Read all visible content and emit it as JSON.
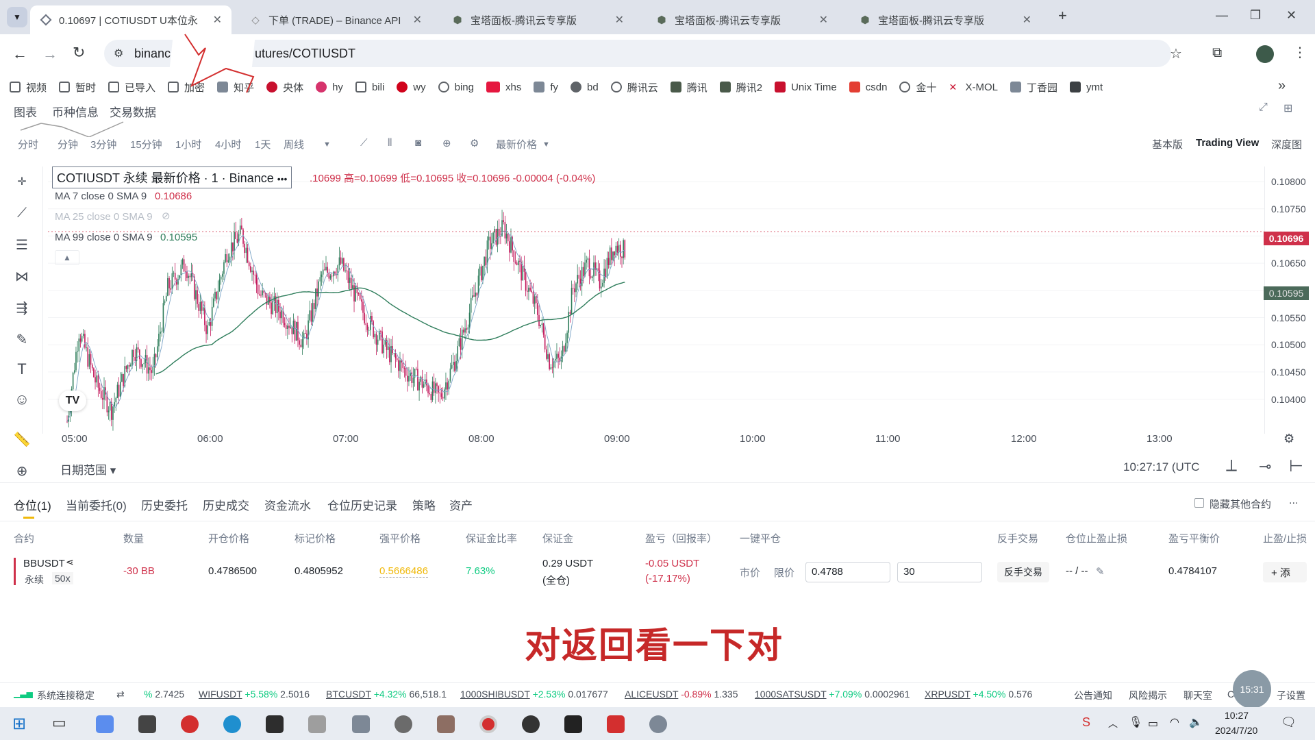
{
  "browser": {
    "tabs": [
      {
        "title": "0.10697 | COTIUSDT U本位永",
        "active": true
      },
      {
        "title": "下单 (TRADE) – Binance API",
        "active": false
      },
      {
        "title": "宝塔面板-腾讯云专享版",
        "active": false
      },
      {
        "title": "宝塔面板-腾讯云专享版",
        "active": false
      },
      {
        "title": "宝塔面板-腾讯云专享版",
        "active": false
      }
    ],
    "new_tab": "+",
    "url_start": "binanc",
    "url_end": "utures/COTIUSDT",
    "bookmarks": [
      "视频",
      "暂时",
      "已导入",
      "加密",
      "知乎",
      "央体",
      "hy",
      "bili",
      "wy",
      "bing",
      "xhs",
      "fy",
      "bd",
      "腾讯云",
      "腾讯",
      "腾讯2",
      "Unix Time",
      "csdn",
      "金十",
      "X-MOL",
      "丁香园",
      "ymt"
    ],
    "more_bookmarks": "»"
  },
  "subnav": [
    "图表",
    "币种信息",
    "交易数据"
  ],
  "intervals": [
    "分时",
    "分钟",
    "3分钟",
    "15分钟",
    "1小时",
    "4小时",
    "1天",
    "周线"
  ],
  "price_type": "最新价格",
  "view_modes": [
    "基本版",
    "Trading View",
    "深度图"
  ],
  "legend": {
    "title": "COTIUSDT 永续 最新价格 · 1 · Binance",
    "ohlc": ".10699 高=0.10699 低=0.10695 收=0.10696 -0.00004 (-0.04%)",
    "ma7": "MA 7 close 0 SMA 9",
    "ma7_val": "0.10686",
    "ma25": "MA 25 close 0 SMA 9",
    "ma99": "MA 99 close 0 SMA 9",
    "ma99_val": "0.10595"
  },
  "y_axis": [
    "0.10800",
    "0.10750",
    "0.10700",
    "0.10650",
    "0.10600",
    "0.10550",
    "0.10500",
    "0.10450",
    "0.10400"
  ],
  "price_tag": "0.10696",
  "ma_tag": "0.10595",
  "x_axis": [
    "05:00",
    "06:00",
    "07:00",
    "08:00",
    "09:00",
    "10:00",
    "11:00",
    "12:00",
    "13:00"
  ],
  "date_range": "日期范围",
  "clock": "10:27:17 (UTC",
  "panel_tabs": [
    "仓位(1)",
    "当前委托(0)",
    "历史委托",
    "历史成交",
    "资金流水",
    "仓位历史记录",
    "策略",
    "资产"
  ],
  "hide_other": "隐藏其他合约",
  "panel_more": "...",
  "columns": [
    "合约",
    "数量",
    "开仓价格",
    "标记价格",
    "强平价格",
    "保证金比率",
    "保证金",
    "盈亏（回报率）",
    "一键平仓",
    "反手交易",
    "仓位止盈止损",
    "盈亏平衡价",
    "止盈/止损"
  ],
  "position": {
    "symbol": "BBUSDT",
    "type": "永续",
    "leverage": "50x",
    "qty": "-30 BB",
    "entry": "0.4786500",
    "mark": "0.4805952",
    "liq": "0.5666486",
    "margin_ratio": "7.63%",
    "margin": "0.29 USDT",
    "margin_mode": "(全仓)",
    "pnl": "-0.05 USDT",
    "roe": "(-17.17%)",
    "market": "市价",
    "limit": "限价",
    "limit_price": "0.4788",
    "limit_qty": "30",
    "reverse": "反手交易",
    "tpsl": "-- / --",
    "breakeven": "0.4784107",
    "add": "+ 添"
  },
  "subtitle": "对返回看一下对",
  "status": {
    "conn": "系统连接稳定",
    "tickers": [
      {
        "sym": "",
        "chg": "%",
        "price": "2.7425"
      },
      {
        "sym": "WIFUSDT",
        "chg": "+5.58%",
        "price": "2.5016"
      },
      {
        "sym": "BTCUSDT",
        "chg": "+4.32%",
        "price": "66,518.1"
      },
      {
        "sym": "1000SHIBUSDT",
        "chg": "+2.53%",
        "price": "0.017677"
      },
      {
        "sym": "ALICEUSDT",
        "chg": "-0.89%",
        "price": "1.335"
      },
      {
        "sym": "1000SATSUSDT",
        "chg": "+7.09%",
        "price": "0.0002961"
      },
      {
        "sym": "XRPUSDT",
        "chg": "+4.50%",
        "price": "0.576"
      }
    ],
    "links": [
      "公告通知",
      "风险揭示",
      "聊天室",
      "C"
    ],
    "settings": "子设置",
    "badge": "15:31"
  },
  "taskbar": {
    "time": "10:27",
    "date": "2024/7/20"
  },
  "colors": {
    "up": "#0ecb81",
    "down": "#cf304a",
    "candle_up": "#2e7d5b",
    "candle_down": "#c2185b",
    "ma99": "#2e7d5b",
    "price_tag": "#cf304a",
    "subtitle": "#c62828"
  }
}
